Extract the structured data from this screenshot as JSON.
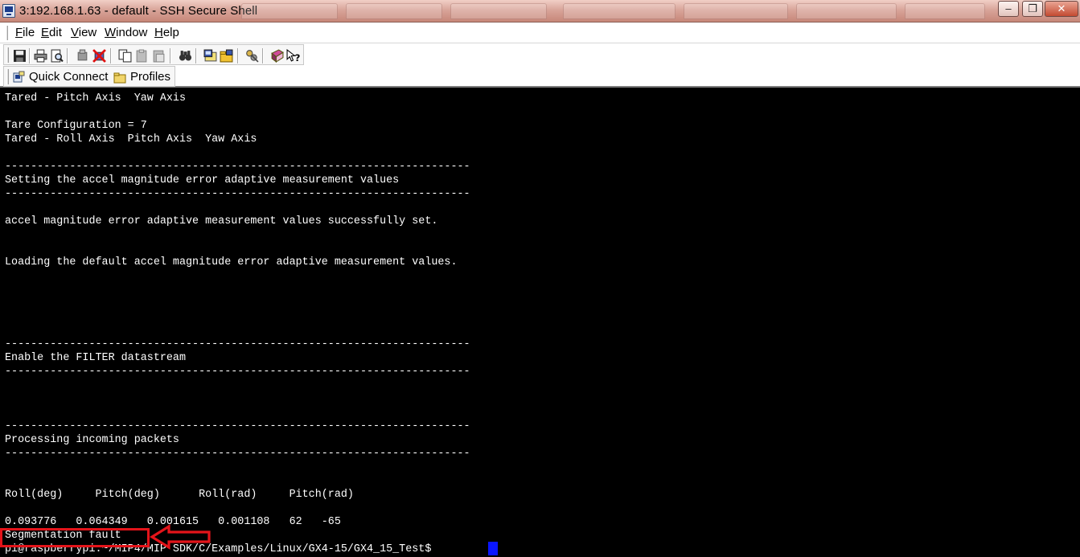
{
  "titlebar": {
    "title": "3:192.168.1.63 - default - SSH Secure Shell",
    "minimize_glyph": "–",
    "maximize_glyph": "❐",
    "close_glyph": "✕"
  },
  "menu": {
    "file": {
      "ul": "F",
      "rest": "ile"
    },
    "edit": {
      "ul": "E",
      "rest": "dit"
    },
    "view": {
      "ul": "V",
      "rest": "iew"
    },
    "window": {
      "ul": "W",
      "rest": "indow"
    },
    "help": {
      "ul": "H",
      "rest": "elp"
    }
  },
  "toolbar": {
    "icons": [
      "save-icon",
      "print-icon",
      "print-preview-icon",
      "connect-icon",
      "disconnect-icon",
      "copy-icon",
      "paste-icon",
      "paste-alt-icon",
      "find-icon",
      "settings-icon",
      "file-transfer-icon",
      "keys-icon",
      "help-book-icon",
      "context-help-icon"
    ]
  },
  "profiles_bar": {
    "quick_connect": "Quick Connect",
    "profiles": "Profiles"
  },
  "terminal": {
    "lines": [
      "Tared - Pitch Axis  Yaw Axis",
      "",
      "Tare Configuration = 7",
      "Tared - Roll Axis  Pitch Axis  Yaw Axis",
      "",
      "------------------------------------------------------------------------",
      "Setting the accel magnitude error adaptive measurement values",
      "------------------------------------------------------------------------",
      "",
      "accel magnitude error adaptive measurement values successfully set.",
      "",
      "",
      "Loading the default accel magnitude error adaptive measurement values.",
      "",
      "",
      "",
      "",
      "",
      "------------------------------------------------------------------------",
      "Enable the FILTER datastream",
      "------------------------------------------------------------------------",
      "",
      "",
      "",
      "------------------------------------------------------------------------",
      "Processing incoming packets",
      "------------------------------------------------------------------------",
      "",
      "",
      "Roll(deg)     Pitch(deg)      Roll(rad)     Pitch(rad)",
      "",
      "0.093776   0.064349   0.001615   0.001108   62   -65",
      "Segmentation fault",
      "pi@raspberrypi:~/MIP4/MIP SDK/C/Examples/Linux/GX4-15/GX4_15_Test$ "
    ]
  },
  "colors": {
    "terminal_bg": "#000000",
    "terminal_fg": "#ffffff",
    "cursor": "#0a16ff",
    "annotation": "#e3141a"
  }
}
